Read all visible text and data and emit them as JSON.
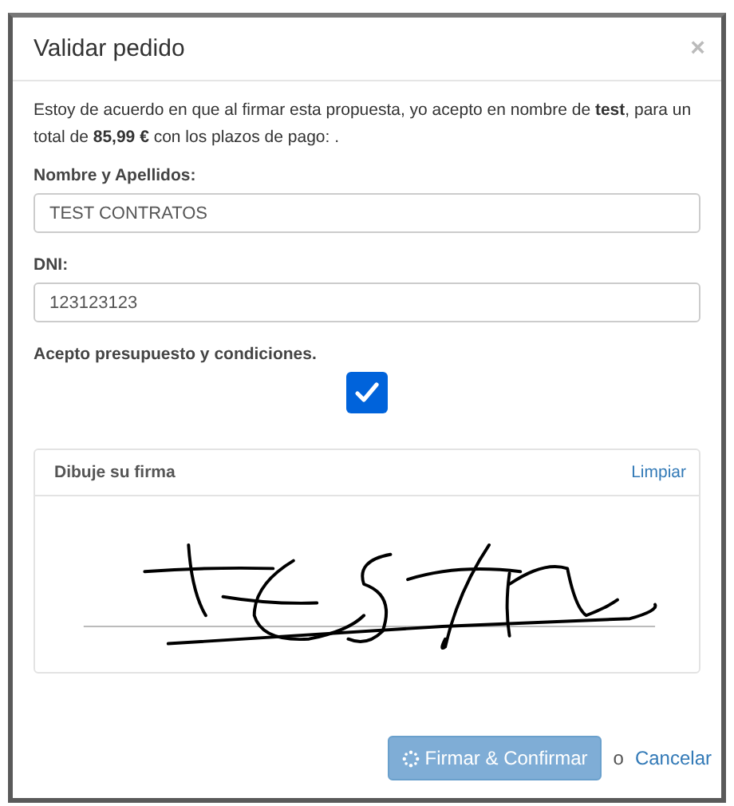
{
  "modal": {
    "title": "Validar pedido",
    "close": "×"
  },
  "intro": "Estoy de acuerdo en que al firmar esta propuesta, yo acepto en nombre de **test**, para un total de **85,99 €** con los plazos de pago: .",
  "fields": [
    {
      "label": "Nombre y Apellidos:",
      "value": "TEST CONTRATOS"
    },
    {
      "label": "DNI:",
      "value": "123123123"
    }
  ],
  "accept": {
    "label": "Acepto presupuesto y condiciones.",
    "checked": true
  },
  "signature": {
    "title": "Dibuje su firma",
    "clear": "Limpiar"
  },
  "footer": {
    "confirm": "Firmar & Confirmar",
    "confirm_disabled": true,
    "separator": "o",
    "cancel": "Cancelar"
  }
}
